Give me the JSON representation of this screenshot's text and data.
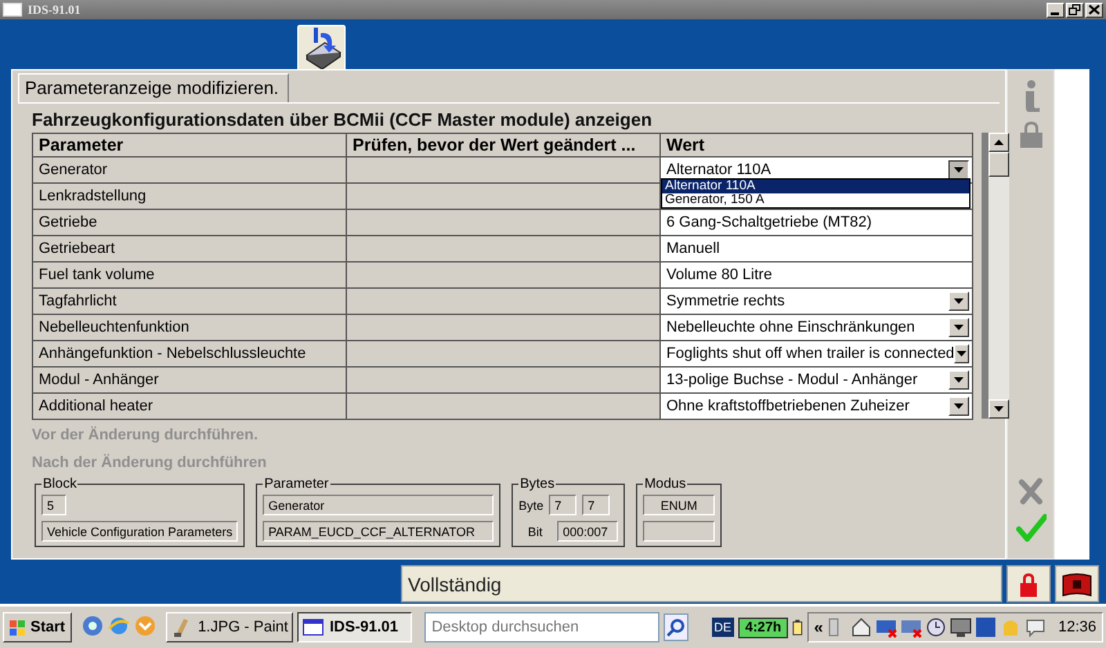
{
  "window": {
    "title": "IDS-91.01"
  },
  "tab": {
    "label": "Parameteranzeige modifizieren.",
    "selected": true
  },
  "heading": "Fahrzeugkonfigurationsdaten über BCMii (CCF Master module) anzeigen",
  "table": {
    "columns": [
      "Parameter",
      "Prüfen, bevor der Wert geändert ...",
      "Wert"
    ],
    "rows": [
      {
        "parameter": "Generator",
        "value": "Alternator 110A",
        "kind": "combo",
        "expanded": true,
        "options": [
          {
            "label": "Alternator 110A",
            "selected": true
          },
          {
            "label": "Generator, 150 A",
            "selected": false
          }
        ]
      },
      {
        "parameter": "Lenkradstellung"
      },
      {
        "parameter": "Getriebe",
        "value": "6 Gang-Schaltgetriebe (MT82)",
        "kind": "text"
      },
      {
        "parameter": "Getriebeart",
        "value": "Manuell",
        "kind": "text"
      },
      {
        "parameter": "Fuel tank volume",
        "value": "Volume 80 Litre",
        "kind": "text"
      },
      {
        "parameter": "Tagfahrlicht",
        "value": "Symmetrie rechts",
        "kind": "combo",
        "expanded": false
      },
      {
        "parameter": "Nebelleuchtenfunktion",
        "value": "Nebelleuchte ohne Einschränkungen",
        "kind": "combo",
        "expanded": false
      },
      {
        "parameter": "Anhängefunktion - Nebelschlussleuchte",
        "value": "Foglights shut off when trailer is connected",
        "kind": "combo",
        "expanded": false
      },
      {
        "parameter": "Modul - Anhänger",
        "value": "13-polige Buchse - Modul - Anhänger",
        "kind": "combo",
        "expanded": false
      },
      {
        "parameter": "Additional heater",
        "value": "Ohne kraftstoffbetriebenen Zuheizer",
        "kind": "combo",
        "expanded": false
      }
    ]
  },
  "steps": [
    {
      "label": "Vor der Änderung durchführen.",
      "disabled": true
    },
    {
      "label": "Nach der Änderung durchführen",
      "disabled": true
    }
  ],
  "details": {
    "block": {
      "legend": "Block",
      "number": "5",
      "name": "Vehicle Configuration Parameters"
    },
    "parameter": {
      "legend": "Parameter",
      "name": "Generator",
      "id": "PARAM_EUCD_CCF_ALTERNATOR"
    },
    "bytes": {
      "legend": "Bytes",
      "byte_label": "Byte",
      "byte_from": "7",
      "byte_to": "7",
      "bit_label": "Bit",
      "bit": "000:007"
    },
    "mode": {
      "legend": "Modus",
      "value": "ENUM"
    }
  },
  "status": "Vollständig",
  "taskbar": {
    "start": "Start",
    "tasks": [
      {
        "label": "1.JPG - Paint",
        "selected": false
      },
      {
        "label": "IDS-91.01",
        "selected": true
      }
    ],
    "search": {
      "placeholder": "Desktop durchsuchen"
    },
    "language": "DE",
    "battery": "4:27h",
    "tray_toggle": "«",
    "clock": "12:36"
  }
}
